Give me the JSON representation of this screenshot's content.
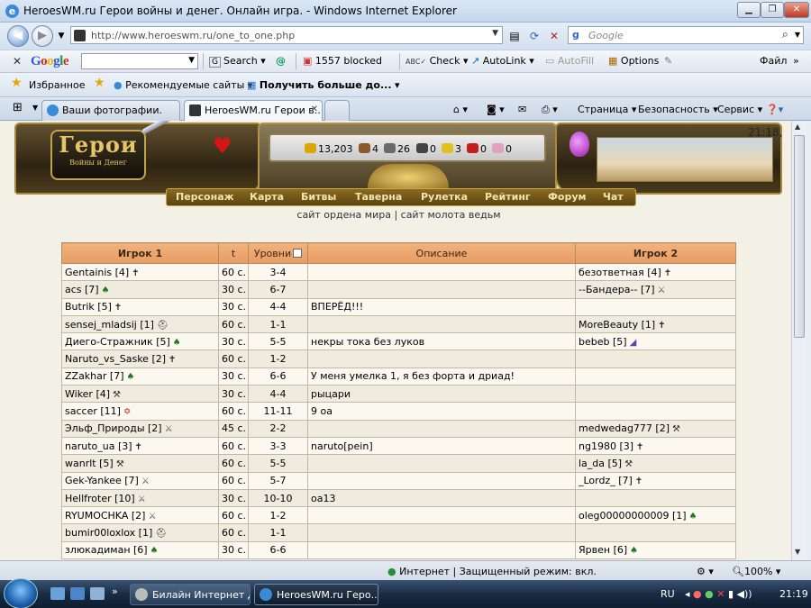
{
  "window": {
    "title": "HeroesWM.ru Герои войны и денег. Онлайн игра. - Windows Internet Explorer"
  },
  "address": {
    "url": "http://www.heroeswm.ru/one_to_one.php",
    "search_placeholder": "Google"
  },
  "google_bar": {
    "logo": "Google",
    "search": "Search",
    "blocked": "1557 blocked",
    "check": "Check",
    "autolink": "AutoLink",
    "autofill": "AutoFill",
    "options": "Options",
    "file_menu": "Файл"
  },
  "favorites": {
    "favorites": "Избранное",
    "recommended": "Рекомендуемые сайты",
    "get_more": "Получить больше до..."
  },
  "tabs": [
    {
      "label": "Ваши фотографии."
    },
    {
      "label": "HeroesWM.ru Герои в..."
    }
  ],
  "commands": {
    "page": "Страница",
    "safety": "Безопасность",
    "tools": "Сервис"
  },
  "game": {
    "logo_main": "Герои",
    "logo_sub": "Войны и Денег",
    "clock": "21:18,",
    "resources": [
      {
        "value": "13,203",
        "color": "#d9a700"
      },
      {
        "value": "4",
        "color": "#8b5a2b"
      },
      {
        "value": "26",
        "color": "#6a6a6a"
      },
      {
        "value": "0",
        "color": "#444444"
      },
      {
        "value": "3",
        "color": "#e0c020"
      },
      {
        "value": "0",
        "color": "#c02020"
      },
      {
        "value": "0",
        "color": "#e0a0c0"
      }
    ],
    "menu": [
      "Персонаж",
      "Карта",
      "Битвы",
      "Таверна",
      "Рулетка",
      "Рейтинг",
      "Форум",
      "Чат"
    ],
    "links": "сайт ордена мира | сайт молота ведьм"
  },
  "table": {
    "headers": {
      "player1": "Игрок 1",
      "t": "t",
      "levels": "Уровни",
      "desc": "Описание",
      "player2": "Игрок 2"
    },
    "rows": [
      {
        "p1": "Gentainis [4]",
        "f1": "✝",
        "t": "60 с.",
        "lv": "3-4",
        "desc": "",
        "p2": "безответная [4]",
        "f2": "✝"
      },
      {
        "p1": "acs [7]",
        "f1": "♠",
        "t": "30 с.",
        "lv": "6-7",
        "desc": "",
        "p2": "--Бандера-- [7]",
        "f2": "⚔"
      },
      {
        "p1": "Butrik [5]",
        "f1": "✝",
        "t": "30 с.",
        "lv": "4-4",
        "desc": "ВПЕРЁД!!!",
        "p2": "",
        "f2": ""
      },
      {
        "p1": "sensej_mladsij [1]",
        "f1": "⛑",
        "t": "60 с.",
        "lv": "1-1",
        "desc": "",
        "p2": "MoreBeauty [1]",
        "f2": "✝"
      },
      {
        "p1": "Диего-Стражник [5]",
        "f1": "♠",
        "t": "30 с.",
        "lv": "5-5",
        "desc": "некры тока без луков",
        "p2": "bebeb [5]",
        "f2": "◢"
      },
      {
        "p1": "Naruto_vs_Saske [2]",
        "f1": "✝",
        "t": "60 с.",
        "lv": "1-2",
        "desc": "",
        "p2": "",
        "f2": ""
      },
      {
        "p1": "ZZakhar [7]",
        "f1": "♠",
        "t": "30 с.",
        "lv": "6-6",
        "desc": "У меня умелка 1, я без форта и дриад!",
        "p2": "",
        "f2": ""
      },
      {
        "p1": "Wiker [4]",
        "f1": "⚒",
        "t": "30 с.",
        "lv": "4-4",
        "desc": "рыцари",
        "p2": "",
        "f2": ""
      },
      {
        "p1": "saccer [11]",
        "f1": "✡",
        "t": "60 с.",
        "lv": "11-11",
        "desc": "9 оа",
        "p2": "",
        "f2": ""
      },
      {
        "p1": "Эльф_Природы [2]",
        "f1": "⚔",
        "t": "45 с.",
        "lv": "2-2",
        "desc": "",
        "p2": "medwedag777 [2]",
        "f2": "⚒"
      },
      {
        "p1": "naruto_ua [3]",
        "f1": "✝",
        "t": "60 с.",
        "lv": "3-3",
        "desc": "naruto[pein]",
        "p2": "ng1980 [3]",
        "f2": "✝"
      },
      {
        "p1": "wanrlt [5]",
        "f1": "⚒",
        "t": "60 с.",
        "lv": "5-5",
        "desc": "",
        "p2": "la_da [5]",
        "f2": "⚒"
      },
      {
        "p1": "Gek-Yankee [7]",
        "f1": "⚔",
        "t": "60 с.",
        "lv": "5-7",
        "desc": "",
        "p2": "_Lordz_ [7]",
        "f2": "✝"
      },
      {
        "p1": "Hellfroter [10]",
        "f1": "⚔",
        "t": "30 с.",
        "lv": "10-10",
        "desc": "оа13",
        "p2": "",
        "f2": ""
      },
      {
        "p1": "RYUMOCHKA [2]",
        "f1": "⚔",
        "t": "60 с.",
        "lv": "1-2",
        "desc": "",
        "p2": "oleg00000000009 [1]",
        "f2": "♠"
      },
      {
        "p1": "bumir00loxlox [1]",
        "f1": "⛑",
        "t": "60 с.",
        "lv": "1-1",
        "desc": "",
        "p2": "",
        "f2": ""
      },
      {
        "p1": "злюкадиман [6]",
        "f1": "♠",
        "t": "30 с.",
        "lv": "6-6",
        "desc": "",
        "p2": "Ярвен [6]",
        "f2": "♠"
      }
    ]
  },
  "status": {
    "zone": "Интернет | Защищенный режим: вкл.",
    "zoom": "100%"
  },
  "taskbar": {
    "tasks": [
      {
        "label": "Билайн Интернет Д..."
      },
      {
        "label": "HeroesWM.ru Геро..."
      }
    ],
    "lang": "RU",
    "time": "21:19"
  }
}
